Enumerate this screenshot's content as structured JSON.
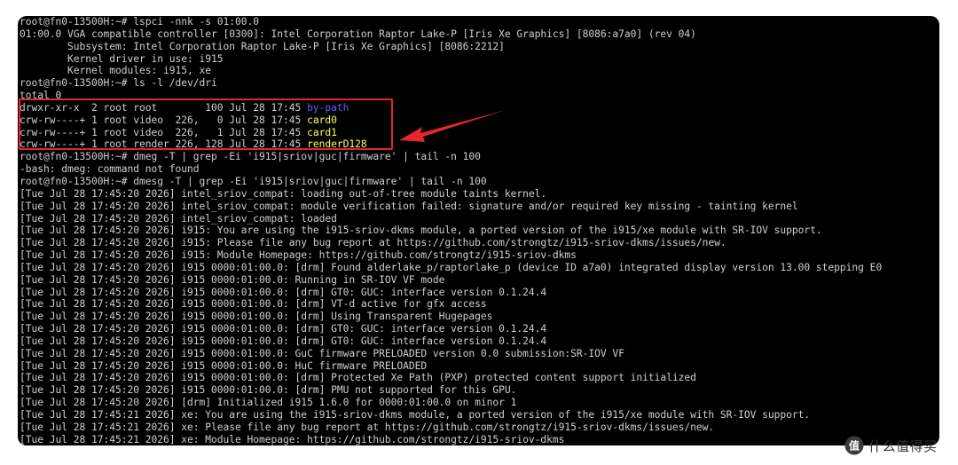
{
  "terminal": {
    "lines": [
      [
        {
          "t": "root@fn0-13500H:~# lspci -nnk -s 01:00.0",
          "c": "plain"
        }
      ],
      [
        {
          "t": "01:00.0 VGA compatible controller [0300]: Intel Corporation Raptor Lake-P [Iris Xe Graphics] [8086:a7a0] (rev 04)",
          "c": "plain"
        }
      ],
      [
        {
          "t": "        Subsystem: Intel Corporation Raptor Lake-P [Iris Xe Graphics] [8086:2212]",
          "c": "plain"
        }
      ],
      [
        {
          "t": "        Kernel driver in use: i915",
          "c": "plain"
        }
      ],
      [
        {
          "t": "        Kernel modules: i915, xe",
          "c": "plain"
        }
      ],
      [
        {
          "t": "root@fn0-13500H:~# ls -l /dev/dri",
          "c": "plain"
        }
      ],
      [
        {
          "t": "total 0",
          "c": "plain"
        }
      ],
      [
        {
          "t": "drwxr-xr-x  2 root root        100 Jul 28 17:45 ",
          "c": "plain"
        },
        {
          "t": "by-path",
          "c": "blue"
        }
      ],
      [
        {
          "t": "crw-rw----+ 1 root video  226,   0 Jul 28 17:45 ",
          "c": "plain"
        },
        {
          "t": "card0",
          "c": "yellow"
        }
      ],
      [
        {
          "t": "crw-rw----+ 1 root video  226,   1 Jul 28 17:45 ",
          "c": "plain"
        },
        {
          "t": "card1",
          "c": "yellow"
        }
      ],
      [
        {
          "t": "crw-rw----+ 1 root render 226, 128 Jul 28 17:45 ",
          "c": "plain"
        },
        {
          "t": "renderD128",
          "c": "yellow"
        }
      ],
      [
        {
          "t": "root@fn0-13500H:~# dmeg -T | grep -Ei 'i915|sriov|guc|firmware' | tail -n 100",
          "c": "plain"
        }
      ],
      [
        {
          "t": "-bash: dmeg: command not found",
          "c": "plain"
        }
      ],
      [
        {
          "t": "root@fn0-13500H:~# dmesg -T | grep -Ei 'i915|sriov|guc|firmware' | tail -n 100",
          "c": "plain"
        }
      ],
      [
        {
          "t": "[Tue Jul 28 17:45:20 2026] intel_sriov_compat: loading out-of-tree module taints kernel.",
          "c": "plain"
        }
      ],
      [
        {
          "t": "[Tue Jul 28 17:45:20 2026] intel_sriov_compat: module verification failed: signature and/or required key missing - tainting kernel",
          "c": "plain"
        }
      ],
      [
        {
          "t": "[Tue Jul 28 17:45:20 2026] intel_sriov_compat: loaded",
          "c": "plain"
        }
      ],
      [
        {
          "t": "[Tue Jul 28 17:45:20 2026] i915: You are using the i915-sriov-dkms module, a ported version of the i915/xe module with SR-IOV support.",
          "c": "plain"
        }
      ],
      [
        {
          "t": "[Tue Jul 28 17:45:20 2026] i915: Please file any bug report at https://github.com/strongtz/i915-sriov-dkms/issues/new.",
          "c": "plain"
        }
      ],
      [
        {
          "t": "[Tue Jul 28 17:45:20 2026] i915: Module Homepage: https://github.com/strongtz/i915-sriov-dkms",
          "c": "plain"
        }
      ],
      [
        {
          "t": "[Tue Jul 28 17:45:20 2026] i915 0000:01:00.0: [drm] Found alderlake_p/raptorlake_p (device ID a7a0) integrated display version 13.00 stepping E0",
          "c": "plain"
        }
      ],
      [
        {
          "t": "[Tue Jul 28 17:45:20 2026] i915 0000:01:00.0: Running in SR-IOV VF mode",
          "c": "plain"
        }
      ],
      [
        {
          "t": "[Tue Jul 28 17:45:20 2026] i915 0000:01:00.0: [drm] GT0: GUC: interface version 0.1.24.4",
          "c": "plain"
        }
      ],
      [
        {
          "t": "[Tue Jul 28 17:45:20 2026] i915 0000:01:00.0: [drm] VT-d active for gfx access",
          "c": "plain"
        }
      ],
      [
        {
          "t": "[Tue Jul 28 17:45:20 2026] i915 0000:01:00.0: [drm] Using Transparent Hugepages",
          "c": "plain"
        }
      ],
      [
        {
          "t": "[Tue Jul 28 17:45:20 2026] i915 0000:01:00.0: [drm] GT0: GUC: interface version 0.1.24.4",
          "c": "plain"
        }
      ],
      [
        {
          "t": "[Tue Jul 28 17:45:20 2026] i915 0000:01:00.0: [drm] GT0: GUC: interface version 0.1.24.4",
          "c": "plain"
        }
      ],
      [
        {
          "t": "[Tue Jul 28 17:45:20 2026] i915 0000:01:00.0: GuC firmware PRELOADED version 0.0 submission:SR-IOV VF",
          "c": "plain"
        }
      ],
      [
        {
          "t": "[Tue Jul 28 17:45:20 2026] i915 0000:01:00.0: HuC firmware PRELOADED",
          "c": "plain"
        }
      ],
      [
        {
          "t": "[Tue Jul 28 17:45:20 2026] i915 0000:01:00.0: [drm] Protected Xe Path (PXP) protected content support initialized",
          "c": "plain"
        }
      ],
      [
        {
          "t": "[Tue Jul 28 17:45:20 2026] i915 0000:01:00.0: [drm] PMU not supported for this GPU.",
          "c": "plain"
        }
      ],
      [
        {
          "t": "[Tue Jul 28 17:45:20 2026] [drm] Initialized i915 1.6.0 for 0000:01:00.0 on minor 1",
          "c": "plain"
        }
      ],
      [
        {
          "t": "[Tue Jul 28 17:45:21 2026] xe: You are using the i915-sriov-dkms module, a ported version of the i915/xe module with SR-IOV support.",
          "c": "plain"
        }
      ],
      [
        {
          "t": "[Tue Jul 28 17:45:21 2026] xe: Please file any bug report at https://github.com/strongtz/i915-sriov-dkms/issues/new.",
          "c": "plain"
        }
      ],
      [
        {
          "t": "[Tue Jul 28 17:45:21 2026] xe: Module Homepage: https://github.com/strongtz/i915-sriov-dkms",
          "c": "plain"
        }
      ]
    ]
  },
  "colors": {
    "background": "#000000",
    "text": "#cfcfcf",
    "directory": "#5c5cff",
    "device": "#ffff55",
    "annotation": "#e5262a"
  },
  "watermark": {
    "logo_text": "值",
    "text": "什么值得买"
  }
}
